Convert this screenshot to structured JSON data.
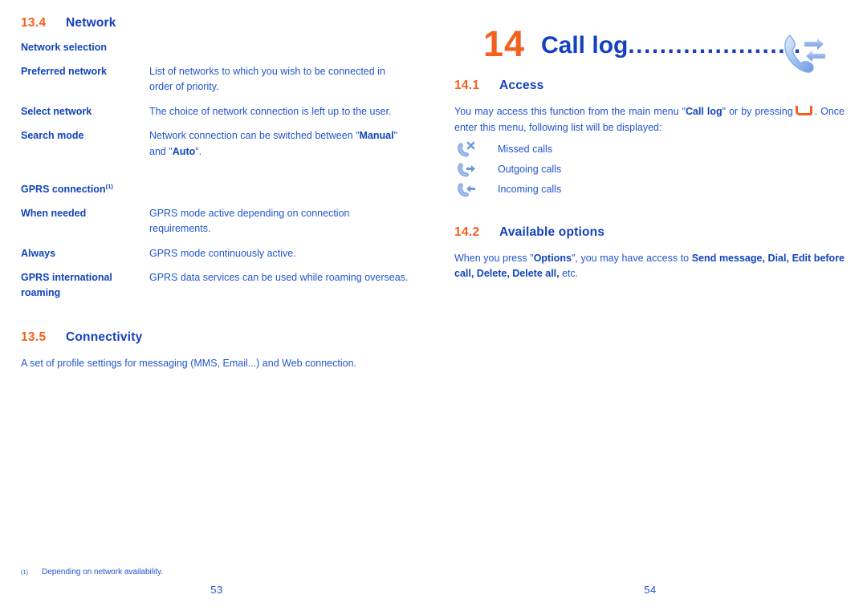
{
  "colors": {
    "accent_orange": "#f4601e",
    "heading_blue": "#1540c0",
    "bold_blue": "#1144bb",
    "body_blue": "#2255cc",
    "icon_blue": "#8aaef0"
  },
  "left_page": {
    "page_number": "53",
    "sections": [
      {
        "number": "13.4",
        "title": "Network",
        "subheading": "Network selection",
        "rows": [
          {
            "term": "Preferred network",
            "desc": "List of networks to which you wish to be connected in order of priority."
          },
          {
            "term": "Select network",
            "desc": "The choice of network connection is left up to the user."
          },
          {
            "term": "Search mode",
            "desc_prefix": "Network connection can be switched between \"",
            "desc_bold1": "Manual",
            "desc_mid": "\" and \"",
            "desc_bold2": "Auto",
            "desc_suffix": "\"."
          }
        ],
        "subheading2": "GPRS connection",
        "subheading2_footnote": "(1)",
        "rows2": [
          {
            "term": "When needed",
            "desc": "GPRS mode active depending on connection requirements."
          },
          {
            "term": "Always",
            "desc": "GPRS mode continuously active."
          },
          {
            "term": "GPRS international roaming",
            "desc": "GPRS data services can be used while roaming overseas."
          }
        ]
      },
      {
        "number": "13.5",
        "title": "Connectivity",
        "body": "A set of profile settings for messaging (MMS, Email...) and Web connection."
      }
    ],
    "footnote": {
      "mark": "(1)",
      "text": "Depending on network availability."
    }
  },
  "right_page": {
    "page_number": "54",
    "chapter": {
      "number": "14",
      "title": "Call log",
      "dots": "......................",
      "icon": "call-log-icon"
    },
    "sections": [
      {
        "number": "14.1",
        "title": "Access",
        "body_part1": "You may access this function from the main menu \"",
        "body_bold1": "Call log",
        "body_part2": "\" or by pressing",
        "key_glyph": "hangup-key-icon",
        "body_part3": ". Once enter this menu, following list will be displayed:",
        "call_list": [
          {
            "icon": "missed-calls-icon",
            "label": "Missed calls"
          },
          {
            "icon": "outgoing-calls-icon",
            "label": "Outgoing calls"
          },
          {
            "icon": "incoming-calls-icon",
            "label": "Incoming calls"
          }
        ]
      },
      {
        "number": "14.2",
        "title": "Available options",
        "body_part1": "When you press \"",
        "body_bold1": "Options",
        "body_part2": "\", you may have access to ",
        "body_bold2": "Send message, Dial, Edit before call, Delete, Delete all,",
        "body_part3": " etc."
      }
    ]
  }
}
